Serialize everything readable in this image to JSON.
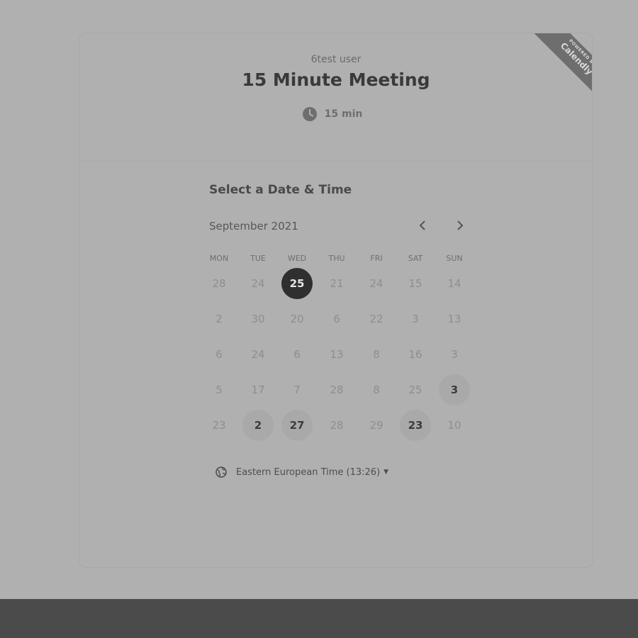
{
  "event": {
    "host_name": "6test user",
    "title": "15 Minute Meeting",
    "duration": "15 min"
  },
  "badge": {
    "line1": "POWERED BY",
    "line2": "Calendly"
  },
  "picker": {
    "section_title": "Select a Date & Time",
    "month_label": "September 2021",
    "prev_icon": "chevron-left-icon",
    "next_icon": "chevron-right-icon",
    "weekdays": [
      "MON",
      "TUE",
      "WED",
      "THU",
      "FRI",
      "SAT",
      "SUN"
    ],
    "weeks": [
      [
        {
          "d": "28"
        },
        {
          "d": "24"
        },
        {
          "d": "25",
          "state": "selected"
        },
        {
          "d": "21"
        },
        {
          "d": "24"
        },
        {
          "d": "15"
        },
        {
          "d": "14"
        }
      ],
      [
        {
          "d": "2"
        },
        {
          "d": "30"
        },
        {
          "d": "20"
        },
        {
          "d": "6"
        },
        {
          "d": "22"
        },
        {
          "d": "3"
        },
        {
          "d": "13"
        }
      ],
      [
        {
          "d": "6"
        },
        {
          "d": "24"
        },
        {
          "d": "6"
        },
        {
          "d": "13"
        },
        {
          "d": "8"
        },
        {
          "d": "16"
        },
        {
          "d": "3"
        }
      ],
      [
        {
          "d": "5"
        },
        {
          "d": "17"
        },
        {
          "d": "7"
        },
        {
          "d": "28"
        },
        {
          "d": "8"
        },
        {
          "d": "25"
        },
        {
          "d": "3",
          "state": "available"
        }
      ],
      [
        {
          "d": "23"
        },
        {
          "d": "2",
          "state": "available"
        },
        {
          "d": "27",
          "state": "available"
        },
        {
          "d": "28"
        },
        {
          "d": "29"
        },
        {
          "d": "23",
          "state": "available"
        },
        {
          "d": "10"
        }
      ]
    ]
  },
  "timezone": {
    "label": "Eastern European Time (13:26)",
    "icon": "globe-icon"
  },
  "colors": {
    "selected_bg": "#2f2f2f",
    "available_bg": "#a9a9a9"
  }
}
